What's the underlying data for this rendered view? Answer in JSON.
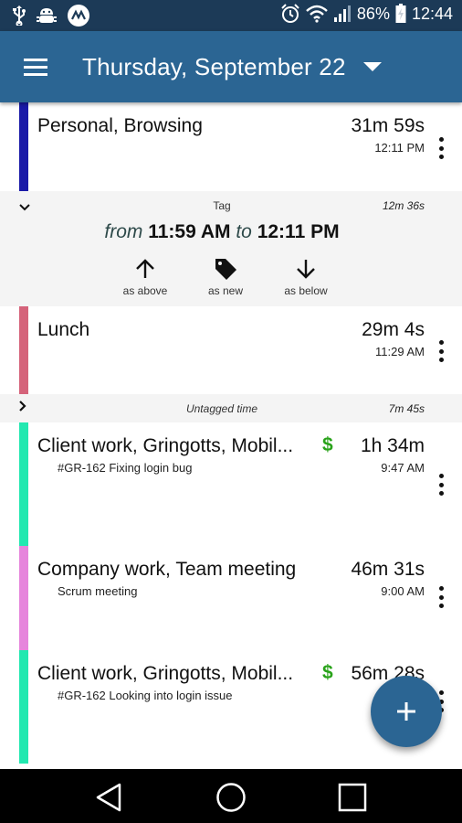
{
  "status_bar": {
    "left_icons": [
      "usb-icon",
      "android-debug-icon",
      "app-notification-icon"
    ],
    "right_icons": [
      "alarm-icon",
      "wifi-icon",
      "signal-icon"
    ],
    "battery_percent": "86%",
    "battery_icon": "battery-charging-icon",
    "time": "12:44"
  },
  "app_bar": {
    "menu_icon": "hamburger-menu-icon",
    "title": "Thursday, September 22",
    "dropdown_icon": "dropdown-triangle-icon",
    "accent_color": "#2b6593"
  },
  "entries": [
    {
      "title": "Personal, Browsing",
      "note": "",
      "duration": "31m 59s",
      "start_time": "12:11 PM",
      "billable": false,
      "color": "#1a1aa8"
    },
    {
      "title": "Lunch",
      "note": "",
      "duration": "29m 4s",
      "start_time": "11:29 AM",
      "billable": false,
      "color": "#d5637a"
    },
    {
      "title": "Client work, Gringotts, Mobil...",
      "note": "#GR-162 Fixing login bug",
      "duration": "1h 34m",
      "start_time": "9:47 AM",
      "billable": true,
      "color": "#22e8b0"
    },
    {
      "title": "Company work, Team meeting",
      "note": "Scrum meeting",
      "duration": "46m 31s",
      "start_time": "9:00 AM",
      "billable": false,
      "color": "#e685dc"
    },
    {
      "title": "Client work, Gringotts, Mobil...",
      "note": "#GR-162 Looking into login issue",
      "duration": "56m 28s",
      "start_time": "",
      "billable": true,
      "color": "#22e8b0"
    }
  ],
  "gap_tag": {
    "label": "Tag",
    "duration": "12m 36s",
    "from_word": "from",
    "from_time": "11:59 AM",
    "to_word": "to",
    "to_time": "12:11 PM",
    "actions": [
      {
        "label": "as above",
        "icon": "arrow-up-icon"
      },
      {
        "label": "as new",
        "icon": "tag-icon"
      },
      {
        "label": "as below",
        "icon": "arrow-down-icon"
      }
    ]
  },
  "gap_untagged": {
    "label": "Untagged time",
    "duration": "7m 45s"
  },
  "billable_symbol": "$",
  "fab": {
    "icon": "plus-icon",
    "symbol": "+"
  },
  "nav_bar": {
    "buttons": [
      "back-icon",
      "home-icon",
      "recents-icon"
    ]
  }
}
